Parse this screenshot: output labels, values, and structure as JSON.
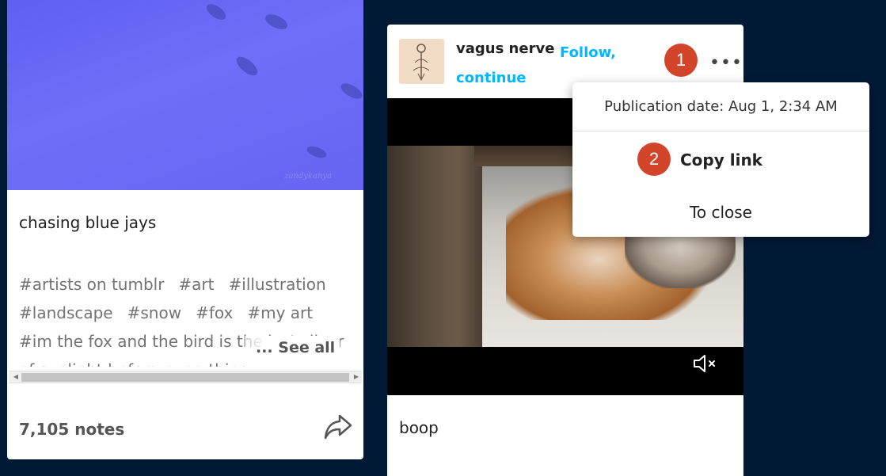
{
  "left_post": {
    "caption": "chasing blue jays",
    "tags": [
      "#artists on tumblr",
      "#art",
      "#illustration",
      "#landscape",
      "#snow",
      "#fox",
      "#my art",
      "#im the fox and the bird is the last sliver of sunlight before everything"
    ],
    "see_all": "... See all",
    "notes": "7,105 notes",
    "art_signature": "zandykanya"
  },
  "center_post": {
    "blog_name": "vagus nerve",
    "follow_label": "Follow, continue",
    "more_label": "•••",
    "caption": "boop",
    "icons": {
      "more": "more-options-icon",
      "mute": "speaker-muted-icon",
      "share": "share-icon"
    }
  },
  "popup": {
    "publication_date": "Publication date: Aug 1, 2:34 AM",
    "copy_link": "Copy link",
    "close": "To close"
  },
  "badges": {
    "first": "1",
    "second": "2"
  },
  "colors": {
    "background": "#001935",
    "accent_link": "#00b8ff",
    "badge": "#d2452b",
    "art_blue": "#6e6ef8"
  }
}
